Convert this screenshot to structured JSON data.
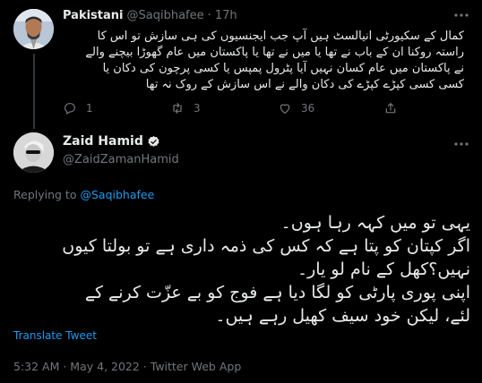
{
  "reply_tweet": {
    "author_name": "Pakistani",
    "author_handle": "@Saqibhafee",
    "time": "· 17h",
    "lines": [
      "کمال کے سکیورٹی انیالسٹ ہیں آپ جب ایجنسیوں کی ہی سازش تو اس کا",
      "راستہ روکنا ان کے باب نے تھا یا میں نے تھا یا پاکستان میں عام گھوڑا بیچنے والے",
      "نے پاکستان میں عام کسان نہیں آیا پٹرول پمپس یا کسی پرچون کی دکان یا",
      "کسی کسی کپڑے کپڑے کی دکان والے نے اس سازش کے روک نہ تھا"
    ],
    "replies": "1",
    "retweets": "3",
    "likes": "36"
  },
  "main_tweet": {
    "author_name": "Zaid Hamid",
    "author_handle": "@ZaidZamanHamid",
    "replying_prefix": "Replying to",
    "replying_to": "@Saqibhafee",
    "lines": [
      "یہی تو میں کہہ رہا ہوں۔",
      "اگر کپتان کو پتا ہے کہ کس کی ذمہ داری ہے تو بولتا کیوں",
      "نہیں؟کھل کے نام لو یار۔",
      "اپنی پوری پارٹی کو لگا دیا ہے فوج کو بے عزّت کرنے کے",
      "لئے، لیکن خود سیف کھیل رہے ہیں۔"
    ],
    "translate_label": "Translate Tweet",
    "timestamp": "5:32 AM · May 4, 2022 · Twitter Web App"
  },
  "colors": {
    "background": "#000000",
    "text": "#e7e9ea",
    "muted": "#71767b",
    "accent": "#1d9bf0",
    "divider": "#2f3336"
  },
  "icons": [
    "more-icon",
    "reply-icon",
    "retweet-icon",
    "like-icon",
    "share-icon",
    "verified-badge-icon"
  ]
}
